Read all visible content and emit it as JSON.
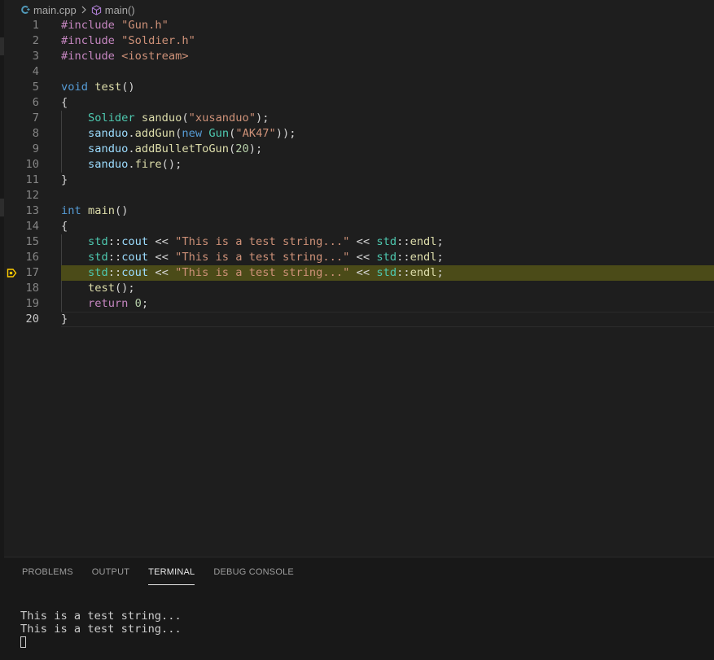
{
  "breadcrumb": {
    "file": "main.cpp",
    "symbol": "main()"
  },
  "colors": {
    "preprocessor": "#c586c0",
    "string": "#ce9178",
    "keyword": "#569cd6",
    "function": "#dcdcaa",
    "type": "#4ec9b0",
    "variable": "#9cdcfe",
    "number": "#b5cea8",
    "highlight": "#4b4b18",
    "breakpoint": "#ffcc00"
  },
  "editor": {
    "lines": [
      {
        "n": "1",
        "tokens": [
          [
            "pre",
            "#include "
          ],
          [
            "str",
            "\"Gun.h\""
          ]
        ]
      },
      {
        "n": "2",
        "tokens": [
          [
            "pre",
            "#include "
          ],
          [
            "str",
            "\"Soldier.h\""
          ]
        ]
      },
      {
        "n": "3",
        "tokens": [
          [
            "pre",
            "#include "
          ],
          [
            "str",
            "<iostream>"
          ]
        ]
      },
      {
        "n": "4",
        "tokens": []
      },
      {
        "n": "5",
        "tokens": [
          [
            "kw",
            "void"
          ],
          [
            "pun",
            " "
          ],
          [
            "fn",
            "test"
          ],
          [
            "pun",
            "()"
          ]
        ]
      },
      {
        "n": "6",
        "tokens": [
          [
            "pun",
            "{"
          ]
        ]
      },
      {
        "n": "7",
        "tokens": [
          [
            "pun",
            "    "
          ],
          [
            "type",
            "Solider"
          ],
          [
            "pun",
            " "
          ],
          [
            "fn",
            "sanduo"
          ],
          [
            "pun",
            "("
          ],
          [
            "str",
            "\"xusanduo\""
          ],
          [
            "pun",
            ");"
          ]
        ]
      },
      {
        "n": "8",
        "tokens": [
          [
            "pun",
            "    "
          ],
          [
            "var",
            "sanduo"
          ],
          [
            "pun",
            "."
          ],
          [
            "fn",
            "addGun"
          ],
          [
            "pun",
            "("
          ],
          [
            "kw",
            "new"
          ],
          [
            "pun",
            " "
          ],
          [
            "type",
            "Gun"
          ],
          [
            "pun",
            "("
          ],
          [
            "str",
            "\"AK47\""
          ],
          [
            "pun",
            "));"
          ]
        ]
      },
      {
        "n": "9",
        "tokens": [
          [
            "pun",
            "    "
          ],
          [
            "var",
            "sanduo"
          ],
          [
            "pun",
            "."
          ],
          [
            "fn",
            "addBulletToGun"
          ],
          [
            "pun",
            "("
          ],
          [
            "num",
            "20"
          ],
          [
            "pun",
            ");"
          ]
        ]
      },
      {
        "n": "10",
        "tokens": [
          [
            "pun",
            "    "
          ],
          [
            "var",
            "sanduo"
          ],
          [
            "pun",
            "."
          ],
          [
            "fn",
            "fire"
          ],
          [
            "pun",
            "();"
          ]
        ]
      },
      {
        "n": "11",
        "tokens": [
          [
            "pun",
            "}"
          ]
        ]
      },
      {
        "n": "12",
        "tokens": []
      },
      {
        "n": "13",
        "tokens": [
          [
            "kw",
            "int"
          ],
          [
            "pun",
            " "
          ],
          [
            "fn",
            "main"
          ],
          [
            "pun",
            "()"
          ]
        ]
      },
      {
        "n": "14",
        "tokens": [
          [
            "pun",
            "{"
          ]
        ]
      },
      {
        "n": "15",
        "tokens": [
          [
            "pun",
            "    "
          ],
          [
            "type",
            "std"
          ],
          [
            "pun",
            "::"
          ],
          [
            "var",
            "cout"
          ],
          [
            "pun",
            " << "
          ],
          [
            "str",
            "\"This is a test string...\""
          ],
          [
            "pun",
            " << "
          ],
          [
            "type",
            "std"
          ],
          [
            "pun",
            "::"
          ],
          [
            "fn",
            "endl"
          ],
          [
            "pun",
            ";"
          ]
        ]
      },
      {
        "n": "16",
        "tokens": [
          [
            "pun",
            "    "
          ],
          [
            "type",
            "std"
          ],
          [
            "pun",
            "::"
          ],
          [
            "var",
            "cout"
          ],
          [
            "pun",
            " << "
          ],
          [
            "str",
            "\"This is a test string...\""
          ],
          [
            "pun",
            " << "
          ],
          [
            "type",
            "std"
          ],
          [
            "pun",
            "::"
          ],
          [
            "fn",
            "endl"
          ],
          [
            "pun",
            ";"
          ]
        ]
      },
      {
        "n": "17",
        "tokens": [
          [
            "pun",
            "    "
          ],
          [
            "type",
            "std"
          ],
          [
            "pun",
            "::"
          ],
          [
            "var",
            "cout"
          ],
          [
            "pun",
            " << "
          ],
          [
            "str",
            "\"This is a test string...\""
          ],
          [
            "pun",
            " << "
          ],
          [
            "type",
            "std"
          ],
          [
            "pun",
            "::"
          ],
          [
            "fn",
            "endl"
          ],
          [
            "pun",
            ";"
          ]
        ],
        "highlight": true,
        "breakpoint": true
      },
      {
        "n": "18",
        "tokens": [
          [
            "pun",
            "    "
          ],
          [
            "fn",
            "test"
          ],
          [
            "pun",
            "();"
          ]
        ]
      },
      {
        "n": "19",
        "tokens": [
          [
            "pun",
            "    "
          ],
          [
            "ctl",
            "return"
          ],
          [
            "pun",
            " "
          ],
          [
            "num",
            "0"
          ],
          [
            "pun",
            ";"
          ]
        ]
      },
      {
        "n": "20",
        "tokens": [
          [
            "pun",
            "}"
          ]
        ],
        "current": true
      }
    ]
  },
  "panel": {
    "tabs": [
      {
        "label": "PROBLEMS",
        "active": false
      },
      {
        "label": "OUTPUT",
        "active": false
      },
      {
        "label": "TERMINAL",
        "active": true
      },
      {
        "label": "DEBUG CONSOLE",
        "active": false
      }
    ],
    "terminal_lines": [
      "This is a test string...",
      "This is a test string..."
    ]
  }
}
